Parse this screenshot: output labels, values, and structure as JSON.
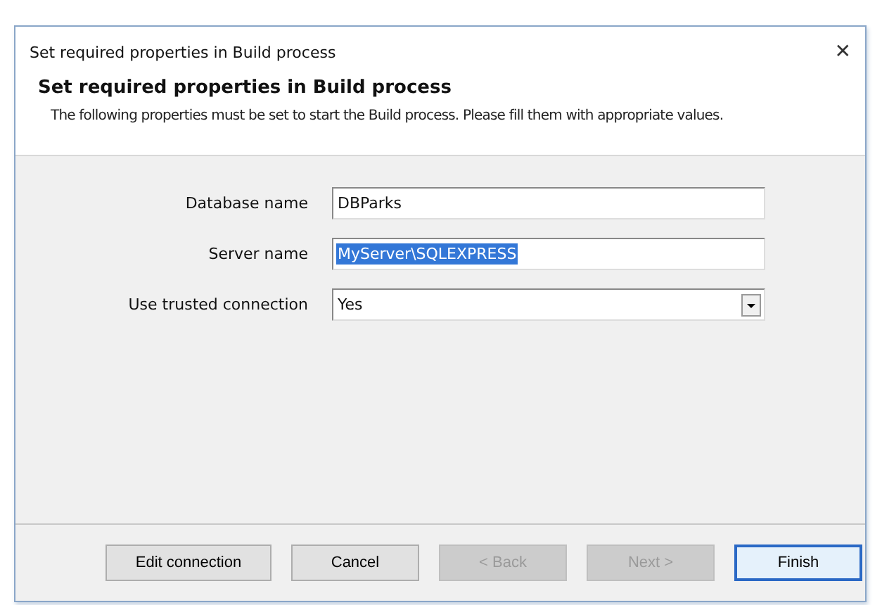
{
  "window": {
    "title": "Set required properties in Build process",
    "close": "✕"
  },
  "header": {
    "title": "Set required properties in Build process",
    "description": "The following properties must be set to start the Build process. Please fill them with appropriate values."
  },
  "fields": [
    {
      "label": "Database name",
      "kind": "text",
      "value": "DBParks",
      "text_selected": false
    },
    {
      "label": "Server name",
      "kind": "text",
      "value": "MyServer\\SQLEXPRESS",
      "text_selected": true
    },
    {
      "label": "Use trusted connection",
      "kind": "dropdown",
      "value": "Yes",
      "text_selected": false
    }
  ],
  "buttons": [
    {
      "label": "Edit connection",
      "disabled": false,
      "default": false
    },
    {
      "label": "Cancel",
      "disabled": false,
      "default": false
    },
    {
      "label": "< Back",
      "disabled": true,
      "default": false
    },
    {
      "label": "Next >",
      "disabled": true,
      "default": false
    },
    {
      "label": "Finish",
      "disabled": false,
      "default": true
    }
  ]
}
